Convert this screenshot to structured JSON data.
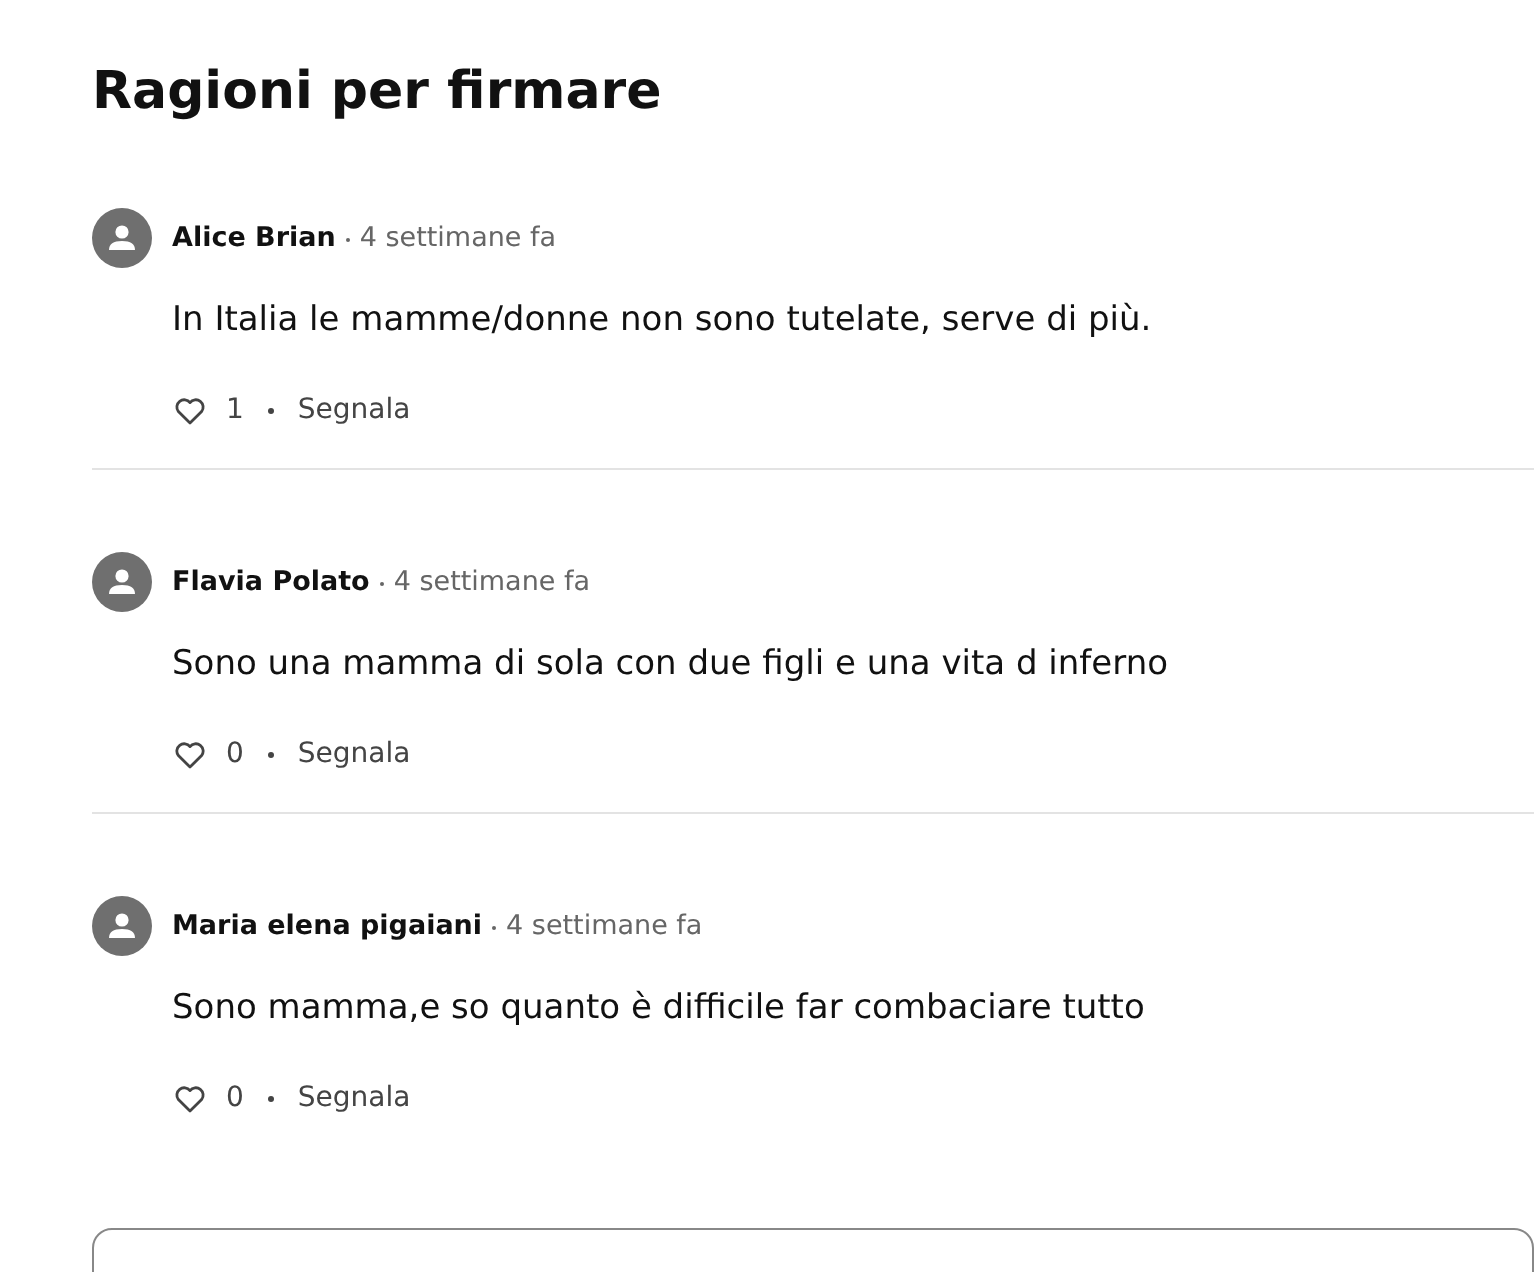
{
  "title": "Ragioni per firmare",
  "comments": [
    {
      "author": "Alice Brian",
      "time": "4 settimane fa",
      "text": "In Italia le mamme/donne non sono tutelate, serve di più.",
      "likes": "1",
      "report": "Segnala"
    },
    {
      "author": "Flavia Polato",
      "time": "4 settimane fa",
      "text": "Sono una mamma di sola con due figli e una vita d inferno",
      "likes": "0",
      "report": "Segnala"
    },
    {
      "author": "Maria elena pigaiani",
      "time": "4 settimane fa",
      "text": "Sono mamma,e so quanto è difficile far combaciare tutto",
      "likes": "0",
      "report": "Segnala"
    }
  ]
}
